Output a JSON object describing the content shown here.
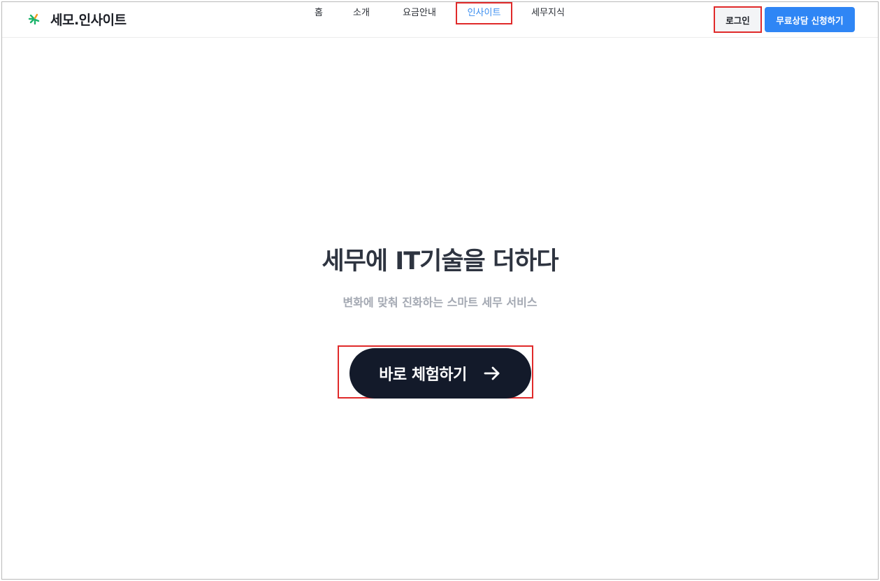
{
  "header": {
    "logo_text": "세모.인사이트",
    "nav": [
      {
        "label": "홈",
        "active": false
      },
      {
        "label": "소개",
        "active": false
      },
      {
        "label": "요금안내",
        "active": false
      },
      {
        "label": "인사이트",
        "active": true
      },
      {
        "label": "세무지식",
        "active": false
      }
    ],
    "login_label": "로그인",
    "cta_label": "무료상담 신청하기"
  },
  "hero": {
    "title": "세무에 IT기술을 더하다",
    "subtitle": "변화에 맞춰 진화하는 스마트 세무 서비스",
    "button_label": "바로 체험하기",
    "button_icon": "arrow-right-icon"
  },
  "colors": {
    "accent": "#2f86f5",
    "active_nav": "#3b8ef0",
    "highlight": "#e02a2a",
    "dark_button": "#131a2a",
    "logo_green": "#1bb36b",
    "logo_orange": "#f39a1c"
  }
}
